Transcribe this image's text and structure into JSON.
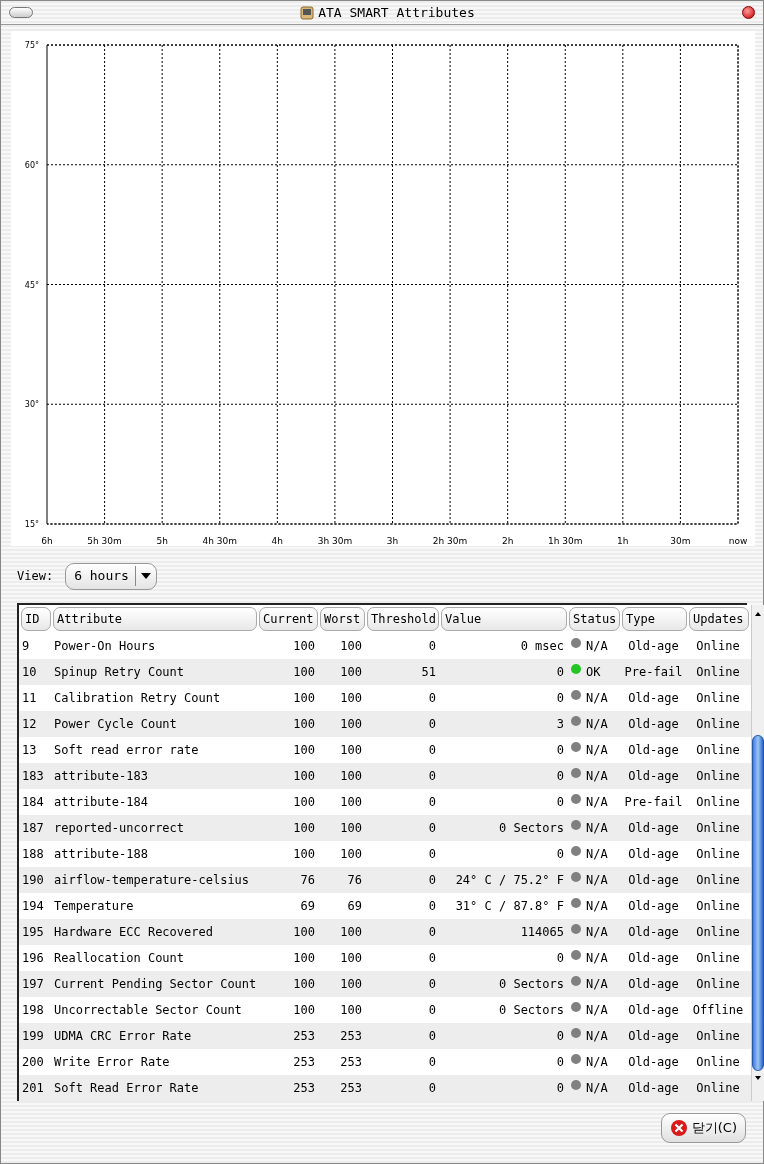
{
  "window": {
    "title": "ATA SMART Attributes"
  },
  "chart": {
    "chart_data": {
      "type": "line",
      "grid": true,
      "ylim": [
        15,
        75
      ],
      "yticks": [
        {
          "value": 75,
          "label": "75°"
        },
        {
          "value": 60,
          "label": "60°"
        },
        {
          "value": 45,
          "label": "45°"
        },
        {
          "value": 30,
          "label": "30°"
        },
        {
          "value": 15,
          "label": "15°"
        }
      ],
      "categories": [
        "6h",
        "5h 30m",
        "5h",
        "4h 30m",
        "4h",
        "3h 30m",
        "3h",
        "2h 30m",
        "2h",
        "1h 30m",
        "1h",
        "30m",
        "now"
      ]
    }
  },
  "view": {
    "label": "View:",
    "value": "6 hours"
  },
  "table": {
    "columns": [
      "ID",
      "Attribute",
      "Current",
      "Worst",
      "Threshold",
      "Value",
      "Status",
      "Type",
      "Updates"
    ],
    "rows": [
      {
        "id": "9",
        "attribute": "Power-On Hours",
        "current": "100",
        "worst": "100",
        "threshold": "0",
        "value": "0 msec",
        "status": "N/A",
        "color": "#808080",
        "type": "Old-age",
        "updates": "Online"
      },
      {
        "id": "10",
        "attribute": "Spinup Retry Count",
        "current": "100",
        "worst": "100",
        "threshold": "51",
        "value": "0",
        "status": "OK",
        "color": "#22c522",
        "type": "Pre-fail",
        "updates": "Online"
      },
      {
        "id": "11",
        "attribute": "Calibration Retry Count",
        "current": "100",
        "worst": "100",
        "threshold": "0",
        "value": "0",
        "status": "N/A",
        "color": "#808080",
        "type": "Old-age",
        "updates": "Online"
      },
      {
        "id": "12",
        "attribute": "Power Cycle Count",
        "current": "100",
        "worst": "100",
        "threshold": "0",
        "value": "3",
        "status": "N/A",
        "color": "#808080",
        "type": "Old-age",
        "updates": "Online"
      },
      {
        "id": "13",
        "attribute": "Soft read error rate",
        "current": "100",
        "worst": "100",
        "threshold": "0",
        "value": "0",
        "status": "N/A",
        "color": "#808080",
        "type": "Old-age",
        "updates": "Online"
      },
      {
        "id": "183",
        "attribute": "attribute-183",
        "current": "100",
        "worst": "100",
        "threshold": "0",
        "value": "0",
        "status": "N/A",
        "color": "#808080",
        "type": "Old-age",
        "updates": "Online"
      },
      {
        "id": "184",
        "attribute": "attribute-184",
        "current": "100",
        "worst": "100",
        "threshold": "0",
        "value": "0",
        "status": "N/A",
        "color": "#808080",
        "type": "Pre-fail",
        "updates": "Online"
      },
      {
        "id": "187",
        "attribute": "reported-uncorrect",
        "current": "100",
        "worst": "100",
        "threshold": "0",
        "value": "0 Sectors",
        "status": "N/A",
        "color": "#808080",
        "type": "Old-age",
        "updates": "Online"
      },
      {
        "id": "188",
        "attribute": "attribute-188",
        "current": "100",
        "worst": "100",
        "threshold": "0",
        "value": "0",
        "status": "N/A",
        "color": "#808080",
        "type": "Old-age",
        "updates": "Online"
      },
      {
        "id": "190",
        "attribute": "airflow-temperature-celsius",
        "current": "76",
        "worst": "76",
        "threshold": "0",
        "value": "24° C / 75.2° F",
        "status": "N/A",
        "color": "#808080",
        "type": "Old-age",
        "updates": "Online"
      },
      {
        "id": "194",
        "attribute": "Temperature",
        "current": "69",
        "worst": "69",
        "threshold": "0",
        "value": "31° C / 87.8° F",
        "status": "N/A",
        "color": "#808080",
        "type": "Old-age",
        "updates": "Online"
      },
      {
        "id": "195",
        "attribute": "Hardware ECC Recovered",
        "current": "100",
        "worst": "100",
        "threshold": "0",
        "value": "114065",
        "status": "N/A",
        "color": "#808080",
        "type": "Old-age",
        "updates": "Online"
      },
      {
        "id": "196",
        "attribute": "Reallocation Count",
        "current": "100",
        "worst": "100",
        "threshold": "0",
        "value": "0",
        "status": "N/A",
        "color": "#808080",
        "type": "Old-age",
        "updates": "Online"
      },
      {
        "id": "197",
        "attribute": "Current Pending Sector Count",
        "current": "100",
        "worst": "100",
        "threshold": "0",
        "value": "0 Sectors",
        "status": "N/A",
        "color": "#808080",
        "type": "Old-age",
        "updates": "Online"
      },
      {
        "id": "198",
        "attribute": "Uncorrectable Sector Count",
        "current": "100",
        "worst": "100",
        "threshold": "0",
        "value": "0 Sectors",
        "status": "N/A",
        "color": "#808080",
        "type": "Old-age",
        "updates": "Offline"
      },
      {
        "id": "199",
        "attribute": "UDMA CRC Error Rate",
        "current": "253",
        "worst": "253",
        "threshold": "0",
        "value": "0",
        "status": "N/A",
        "color": "#808080",
        "type": "Old-age",
        "updates": "Online"
      },
      {
        "id": "200",
        "attribute": "Write Error Rate",
        "current": "253",
        "worst": "253",
        "threshold": "0",
        "value": "0",
        "status": "N/A",
        "color": "#808080",
        "type": "Old-age",
        "updates": "Online"
      },
      {
        "id": "201",
        "attribute": "Soft Read Error Rate",
        "current": "253",
        "worst": "253",
        "threshold": "0",
        "value": "0",
        "status": "N/A",
        "color": "#808080",
        "type": "Old-age",
        "updates": "Online"
      }
    ]
  },
  "close_button": {
    "label": "닫기(C)"
  }
}
